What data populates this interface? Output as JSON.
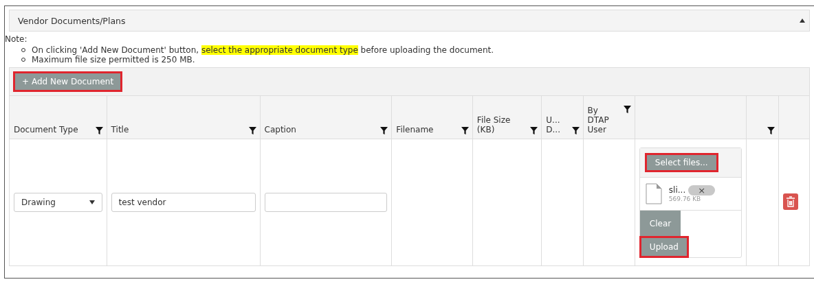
{
  "panel": {
    "title": "Vendor Documents/Plans",
    "expanded": true
  },
  "note": {
    "label": "Note:",
    "items": [
      {
        "parts": [
          {
            "text": "On clicking 'Add New Document' button, ",
            "highlighted": false
          },
          {
            "text": "select the appropriate document type",
            "highlighted": true
          },
          {
            "text": " before uploading the document.",
            "highlighted": false
          }
        ]
      },
      {
        "parts": [
          {
            "text": "Maximum file size permitted is 250 MB.",
            "highlighted": false
          }
        ]
      }
    ]
  },
  "toolbar": {
    "add_button": {
      "icon": "+",
      "label": "Add New Document",
      "highlighted": true
    }
  },
  "table": {
    "columns": [
      {
        "label": "Document Type",
        "filter": true
      },
      {
        "label": "Title",
        "filter": true
      },
      {
        "label": "Caption",
        "filter": true
      },
      {
        "label": "Filename",
        "filter": true
      },
      {
        "label": "File Size (KB)",
        "filter": true
      },
      {
        "label": "U... D...",
        "filter": true
      },
      {
        "label": "By DTAP User",
        "filter": true
      },
      {
        "filter": false
      },
      {
        "filter": true
      },
      {
        "filter": false
      }
    ],
    "rows": [
      {
        "document_type": "Drawing",
        "title": "test vendor",
        "caption": "",
        "upload": {
          "select_button": {
            "label": "Select files...",
            "highlighted": true
          },
          "file": {
            "name": "sli...",
            "size": "569.76 KB",
            "remove": "×"
          },
          "clear_button": {
            "label": "Clear",
            "highlighted": false
          },
          "upload_button": {
            "label": "Upload",
            "highlighted": true
          }
        }
      }
    ]
  }
}
